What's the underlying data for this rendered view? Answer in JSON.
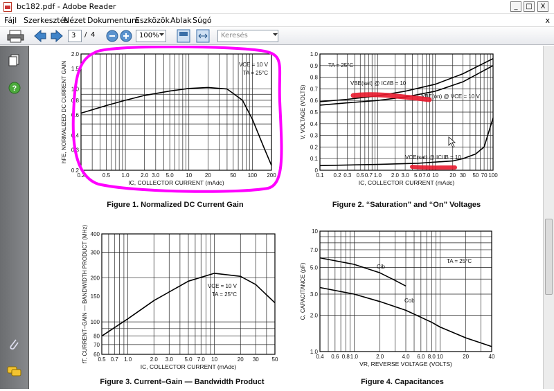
{
  "window": {
    "title": "bc182.pdf - Adobe Reader",
    "minimize": "_",
    "maximize": "□",
    "close": "X"
  },
  "menu": {
    "items": [
      "Fájl",
      "Szerkesztés",
      "Nézet",
      "Dokumentum",
      "Eszközök",
      "Ablak",
      "Súgó"
    ],
    "close": "x"
  },
  "toolbar": {
    "page_current": "3",
    "page_sep": "/",
    "page_total": "4",
    "zoom": "100%",
    "search_placeholder": "Keresés"
  },
  "colors": {
    "annotation": "#ff00ff",
    "highlight": "#e8182c",
    "panel": "#6b6d70"
  },
  "chart_data": [
    {
      "type": "line",
      "title": "Figure 1. Normalized DC Current Gain",
      "xlabel": "IC, COLLECTOR CURRENT (mAdc)",
      "ylabel": "hFE, NORMALIZED DC CURRENT GAIN",
      "xscale": "log",
      "yscale": "log",
      "xlim": [
        0.2,
        200
      ],
      "ylim": [
        0.2,
        2.0
      ],
      "x_ticks": [
        "0.2",
        "0.5",
        "1.0",
        "2.0",
        "3.0",
        "5.0",
        "10",
        "20",
        "50",
        "100",
        "200"
      ],
      "y_ticks": [
        "0.2",
        "0.3",
        "0.4",
        "0.6",
        "0.8",
        "1.0",
        "1.5",
        "2.0"
      ],
      "annotations": [
        "VCE = 10 V",
        "TA = 25°C"
      ],
      "series": [
        {
          "x": [
            0.2,
            0.5,
            1,
            2,
            5,
            10,
            20,
            40,
            70,
            100,
            150,
            200
          ],
          "y": [
            0.62,
            0.72,
            0.8,
            0.88,
            0.96,
            1.01,
            1.03,
            1.0,
            0.8,
            0.55,
            0.32,
            0.22
          ]
        }
      ]
    },
    {
      "type": "line",
      "title": "Figure 2. “Saturation” and “On” Voltages",
      "xlabel": "IC, COLLECTOR CURRENT (mAdc)",
      "ylabel": "V, VOLTAGE (VOLTS)",
      "xscale": "log",
      "xlim": [
        0.1,
        100
      ],
      "ylim": [
        0,
        1.0
      ],
      "x_ticks": [
        "0.1",
        "0.2",
        "0.3",
        "0.5",
        "0.7",
        "1.0",
        "2.0",
        "3.0",
        "5.0",
        "7.0",
        "10",
        "20",
        "30",
        "50",
        "70",
        "100"
      ],
      "y_ticks": [
        "0",
        "0.1",
        "0.2",
        "0.3",
        "0.4",
        "0.5",
        "0.6",
        "0.7",
        "0.8",
        "0.9",
        "1.0"
      ],
      "annotations": [
        "TA = 25°C",
        "VBE(sat) @ IC/IB = 10",
        "VBE(on) @ VCE = 10 V",
        "VCE(sat) @ IC/IB = 10"
      ],
      "series": [
        {
          "name": "VBE(sat) @ IC/IB = 10",
          "x": [
            0.1,
            0.3,
            1,
            3,
            10,
            30,
            100
          ],
          "y": [
            0.59,
            0.61,
            0.64,
            0.68,
            0.74,
            0.83,
            0.96
          ]
        },
        {
          "name": "VBE(on) @ VCE = 10 V",
          "x": [
            0.1,
            0.3,
            1,
            3,
            10,
            30,
            100
          ],
          "y": [
            0.56,
            0.58,
            0.6,
            0.63,
            0.68,
            0.76,
            0.9
          ]
        },
        {
          "name": "VCE(sat) @ IC/IB = 10",
          "x": [
            0.1,
            1,
            5,
            10,
            20,
            30,
            50,
            70,
            100
          ],
          "y": [
            0.04,
            0.05,
            0.06,
            0.07,
            0.08,
            0.1,
            0.14,
            0.2,
            0.45
          ]
        }
      ]
    },
    {
      "type": "line",
      "title": "Figure 3. Current–Gain — Bandwidth Product",
      "xlabel": "IC, COLLECTOR CURRENT (mAdc)",
      "ylabel": "fT, CURRENT–GAIN — BANDWIDTH PRODUCT (MHz)",
      "xscale": "log",
      "yscale": "log",
      "xlim": [
        0.5,
        50
      ],
      "ylim": [
        60,
        400
      ],
      "x_ticks": [
        "0.5",
        "0.7",
        "1.0",
        "2.0",
        "3.0",
        "5.0",
        "7.0",
        "10",
        "20",
        "30",
        "50"
      ],
      "y_ticks": [
        "60",
        "70",
        "80",
        "100",
        "150",
        "200",
        "300",
        "400"
      ],
      "annotations": [
        "VCE = 10 V",
        "TA = 25°C"
      ],
      "series": [
        {
          "x": [
            0.5,
            1,
            2,
            5,
            10,
            20,
            30,
            50
          ],
          "y": [
            80,
            105,
            140,
            190,
            215,
            205,
            180,
            135
          ]
        }
      ]
    },
    {
      "type": "line",
      "title": "Figure 4. Capacitances",
      "xlabel": "VR, REVERSE VOLTAGE (VOLTS)",
      "ylabel": "C, CAPACITANCE (pF)",
      "xscale": "log",
      "yscale": "log",
      "xlim": [
        0.4,
        40
      ],
      "ylim": [
        1.0,
        10
      ],
      "x_ticks": [
        "0.4",
        "0.6",
        "0.8",
        "1.0",
        "2.0",
        "4.0",
        "6.0",
        "8.0",
        "10",
        "20",
        "40"
      ],
      "y_ticks": [
        "1.0",
        "2.0",
        "3.0",
        "5.0",
        "7.0",
        "10"
      ],
      "annotations": [
        "TA = 25°C",
        "Cib",
        "Cob"
      ],
      "series": [
        {
          "name": "Cib",
          "x": [
            0.4,
            1,
            2,
            3,
            4
          ],
          "y": [
            6.0,
            5.3,
            4.5,
            3.9,
            3.5
          ]
        },
        {
          "name": "Cob",
          "x": [
            0.4,
            1,
            2,
            4,
            8,
            10,
            20,
            40
          ],
          "y": [
            3.4,
            3.0,
            2.6,
            2.2,
            1.75,
            1.6,
            1.3,
            1.1
          ]
        }
      ]
    }
  ]
}
